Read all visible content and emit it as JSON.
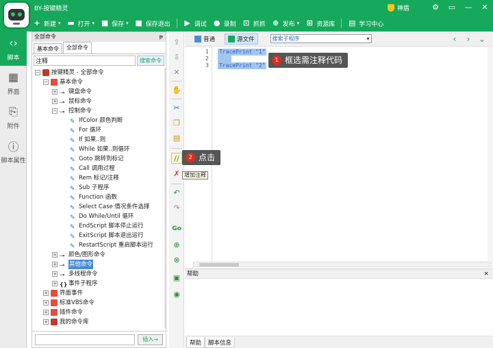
{
  "app": {
    "title": "BY-按键精灵",
    "vip_label": "神盾",
    "colors": {
      "brand_green": "#16a85b",
      "selection": "#a3c6ef",
      "callout_bg": "#555555",
      "badge_red": "#d93025"
    }
  },
  "toolbar": [
    {
      "label": "新建",
      "icon": "plus-icon",
      "glyph": "+",
      "has_menu": true
    },
    {
      "label": "打开",
      "icon": "folder-icon",
      "glyph": "▬",
      "has_menu": true
    },
    {
      "label": "保存",
      "icon": "save-icon",
      "glyph": "■",
      "has_menu": true
    },
    {
      "label": "保存退出",
      "icon": "save-exit-icon",
      "glyph": "■",
      "has_menu": false
    },
    {
      "label": "调试",
      "icon": "play-icon",
      "glyph": "▶",
      "has_menu": false
    },
    {
      "label": "录制",
      "icon": "record-icon",
      "glyph": "●",
      "has_menu": false
    },
    {
      "label": "抓抓",
      "icon": "grab-icon",
      "glyph": "⊡",
      "has_menu": false
    },
    {
      "label": "发布",
      "icon": "publish-icon",
      "glyph": "⊕",
      "has_menu": true
    },
    {
      "label": "资源库",
      "icon": "resource-icon",
      "glyph": "⊞",
      "has_menu": false
    },
    {
      "label": "学习中心",
      "icon": "book-icon",
      "glyph": "▤",
      "has_menu": false
    }
  ],
  "leftnav": [
    {
      "label": "脚本",
      "icon": "script-icon",
      "glyph": "‹›",
      "active": true
    },
    {
      "label": "界面",
      "icon": "interface-icon",
      "glyph": "▦",
      "active": false
    },
    {
      "label": "附件",
      "icon": "attachment-icon",
      "glyph": "⎘",
      "active": false
    },
    {
      "label": "脚本属性",
      "icon": "info-icon",
      "glyph": "ⓘ",
      "active": false
    }
  ],
  "cmdpanel": {
    "title": "全部命令",
    "tabs": [
      "基本命令",
      "全部命令"
    ],
    "search_value": "注释",
    "search_button": "搜索命令",
    "insert_button": "插入→",
    "tree": [
      {
        "label": "按键精灵 - 全部命令",
        "level": 0,
        "toggle": "⊟",
        "icon": "prog"
      },
      {
        "label": "基本命令",
        "level": 1,
        "toggle": "⊟",
        "icon": "folder"
      },
      {
        "label": "键盘命令",
        "level": 2,
        "toggle": "⊞",
        "icon": "key"
      },
      {
        "label": "鼠标命令",
        "level": 2,
        "toggle": "⊞",
        "icon": "key"
      },
      {
        "label": "控制命令",
        "level": 2,
        "toggle": "⊟",
        "icon": "key"
      },
      {
        "label": "IfColor 颜色判断",
        "level": 3,
        "toggle": "",
        "icon": "pen"
      },
      {
        "label": "For 循环",
        "level": 3,
        "toggle": "",
        "icon": "pen"
      },
      {
        "label": "If 如果..则",
        "level": 3,
        "toggle": "",
        "icon": "pen"
      },
      {
        "label": "While 如果..则循环",
        "level": 3,
        "toggle": "",
        "icon": "pen"
      },
      {
        "label": "Goto 跳转到标记",
        "level": 3,
        "toggle": "",
        "icon": "pen"
      },
      {
        "label": "Call 调用过程",
        "level": 3,
        "toggle": "",
        "icon": "pen"
      },
      {
        "label": "Rem 标记/注释",
        "level": 3,
        "toggle": "",
        "icon": "pen"
      },
      {
        "label": "Sub 子程序",
        "level": 3,
        "toggle": "",
        "icon": "pen"
      },
      {
        "label": "Function 函数",
        "level": 3,
        "toggle": "",
        "icon": "pen"
      },
      {
        "label": "Select Case 情况条件选择",
        "level": 3,
        "toggle": "",
        "icon": "pen"
      },
      {
        "label": "Do While/Until 循环",
        "level": 3,
        "toggle": "",
        "icon": "pen"
      },
      {
        "label": "EndScript 脚本停止运行",
        "level": 3,
        "toggle": "",
        "icon": "pen"
      },
      {
        "label": "ExitScript 脚本退出运行",
        "level": 3,
        "toggle": "",
        "icon": "pen"
      },
      {
        "label": "RestartScript 重启脚本运行",
        "level": 3,
        "toggle": "",
        "icon": "pen"
      },
      {
        "label": "颜色/图形命令",
        "level": 2,
        "toggle": "⊞",
        "icon": "key"
      },
      {
        "label": "其他命令",
        "level": 2,
        "toggle": "⊞",
        "icon": "key",
        "highlight": true
      },
      {
        "label": "多线程命令",
        "level": 2,
        "toggle": "⊞",
        "icon": "key"
      },
      {
        "label": "事件子程序",
        "level": 2,
        "toggle": "⊞",
        "icon": "curly"
      },
      {
        "label": "界面事件",
        "level": 1,
        "toggle": "⊞",
        "icon": "folder"
      },
      {
        "label": "标准VBS命令",
        "level": 1,
        "toggle": "⊞",
        "icon": "folder"
      },
      {
        "label": "插件命令",
        "level": 1,
        "toggle": "⊞",
        "icon": "folder"
      },
      {
        "label": "我的命令库",
        "level": 1,
        "toggle": "⊞",
        "icon": "prog"
      }
    ]
  },
  "midbar": {
    "tooltip": "增加注释"
  },
  "editor": {
    "tabs": [
      {
        "label": "普通",
        "selected": false
      },
      {
        "label": "源文件",
        "selected": true
      }
    ],
    "sub_select": "搜索子程序",
    "lines": [
      {
        "num": "1",
        "code": "TracePrint \"1\""
      },
      {
        "num": "2",
        "code": ""
      },
      {
        "num": "3",
        "code": "TracePrint \"2\""
      }
    ],
    "nav_prev": "‹",
    "nav_next": "›",
    "nav_expand": "⌄"
  },
  "callouts": [
    {
      "num": "1",
      "text": "框选需注释代码"
    },
    {
      "num": "2",
      "text": "点击"
    }
  ],
  "help": {
    "title": "帮助",
    "close": "×",
    "tabs": [
      "帮助",
      "脚本信息"
    ]
  },
  "window_buttons": [
    "⚙",
    "▭",
    "—",
    "✕"
  ]
}
